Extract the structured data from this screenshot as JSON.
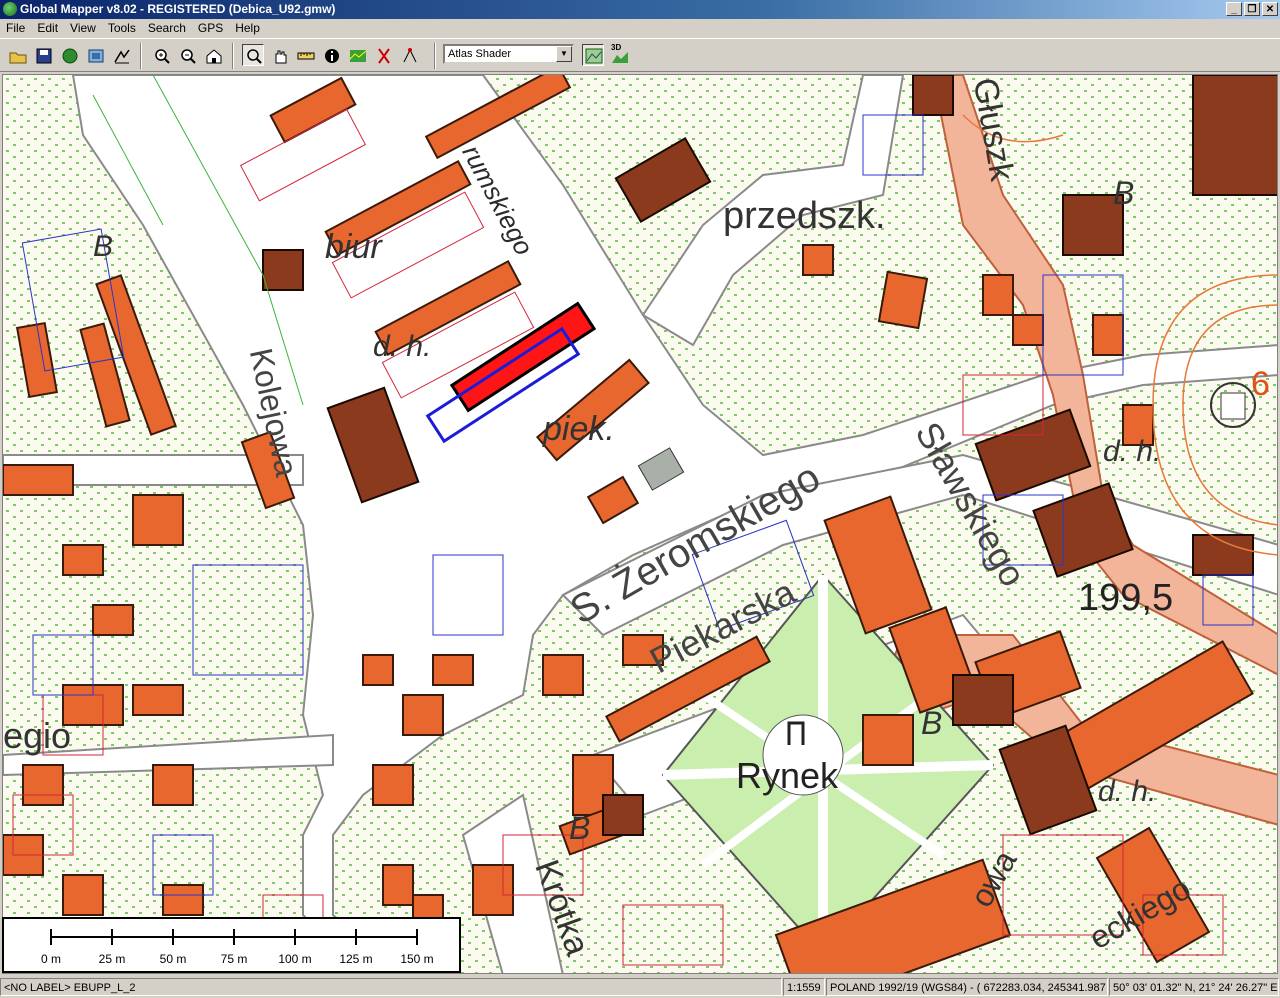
{
  "window": {
    "title": "Global Mapper v8.02 - REGISTERED (Debica_U92.gmw)"
  },
  "menu": [
    "File",
    "Edit",
    "View",
    "Tools",
    "Search",
    "GPS",
    "Help"
  ],
  "toolbar": {
    "shader": "Atlas Shader",
    "btn_3d": "3D"
  },
  "map": {
    "labels": {
      "street_krumskiego": "rumskiego",
      "przedszk": "przedszk.",
      "biur": "biur",
      "dh1": "d. h.",
      "kolejowa": "Kolejowa",
      "piek": "piek.",
      "zeromskiego": "S. Żeromskiego",
      "piekarska": "Piekarska",
      "slawskiego": "Sławskiego",
      "elev": "199,5",
      "rynek": "Rynek",
      "krotka": "Krótka",
      "dh2": "d. h.",
      "b1": "B",
      "b2": "B",
      "b3": "B",
      "b4": "B",
      "glusz": "Głuszk",
      "egion": "egio",
      "eckiego": "eckiego",
      "dh3": "d. h.",
      "num6": "6",
      "owa": "owa"
    }
  },
  "scale": {
    "ticks": [
      "0 m",
      "25 m",
      "50 m",
      "75 m",
      "100 m",
      "125 m",
      "150 m"
    ]
  },
  "status": {
    "layer": "<NO LABEL> EBUPP_L_2",
    "zoom": "1:1559",
    "projection": "POLAND 1992/19 (WGS84) - ( 672283.034, 245341.987 )",
    "latlon": "50° 03' 01.32\" N, 21° 24' 26.27\" E"
  }
}
